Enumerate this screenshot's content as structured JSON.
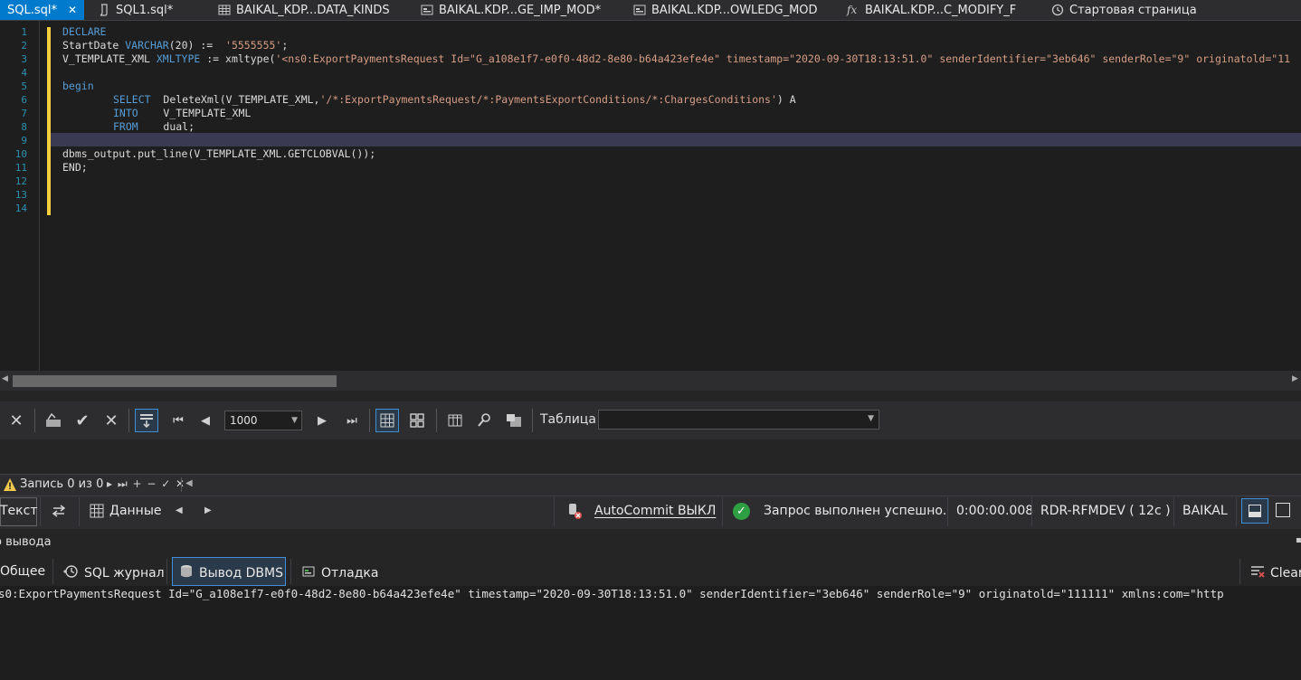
{
  "tabs": [
    {
      "label": "SQL.sql*",
      "icon": "none",
      "active": true
    },
    {
      "label": "SQL1.sql*",
      "icon": "script-icon"
    },
    {
      "label": "BAIKAL_KDP...DATA_KINDS",
      "icon": "table-icon"
    },
    {
      "label": "BAIKAL.KDP...GE_IMP_MOD*",
      "icon": "package-icon"
    },
    {
      "label": "BAIKAL.KDP...OWLEDG_MOD",
      "icon": "package-icon"
    },
    {
      "label": "BAIKAL.KDP...C_MODIFY_F",
      "icon": "function-icon"
    },
    {
      "label": "Стартовая страница",
      "icon": "start-page-icon"
    }
  ],
  "tab_close_symbol": "✕",
  "editor": {
    "line_numbers": [
      "1",
      "2",
      "3",
      "4",
      "5",
      "6",
      "7",
      "8",
      "9",
      "10",
      "11",
      "12",
      "13",
      "14"
    ],
    "lines": {
      "l1_kw": "DECLARE",
      "l2_a": "StartDate ",
      "l2_kw": "VARCHAR",
      "l2_b": "(20) :=  ",
      "l2_str": "'5555555'",
      "l2_c": ";",
      "l3_a": "V_TEMPLATE_XML ",
      "l3_kw": "XMLTYPE",
      "l3_b": " := xmltype(",
      "l3_str": "'<ns0:ExportPaymentsRequest Id=\"G_a108e1f7-e0f0-48d2-8e80-b64a423efe4e\" timestamp=\"2020-09-30T18:13:51.0\" senderIdentifier=\"3eb646\" senderRole=\"9\" originatold=\"11",
      "l5_kw": "begin",
      "l6_kw": "SELECT",
      "l6_a": "  DeleteXml(V_TEMPLATE_XML,",
      "l6_str": "'/*:ExportPaymentsRequest/*:PaymentsExportConditions/*:ChargesConditions'",
      "l6_b": ") A",
      "l7_kw": "INTO",
      "l7_a": "    V_TEMPLATE_XML",
      "l8_kw": "FROM",
      "l8_a": "    dual;",
      "l10": "dbms_output.put_line(V_TEMPLATE_XML.GETCLOBVAL());",
      "l11": "END;"
    }
  },
  "grid_toolbar": {
    "row_limit": "1000",
    "table_label": "Таблица",
    "table_value": ""
  },
  "record_bar": {
    "text": "Запись 0 из 0",
    "nav": "▸ ⏭ + − ✓ ✕"
  },
  "status_bar": {
    "text_tab": "Текст",
    "data_tab": "Данные",
    "autocommit": "AutoCommit ВЫКЛ",
    "query_status": "Запрос выполнен успешно.",
    "elapsed": "0:00:00.008",
    "connection": "RDR-RFMDEV ( 12c )",
    "schema": "BAIKAL"
  },
  "output": {
    "title": "о вывода",
    "tabs": {
      "general": "Общее",
      "sql_log": "SQL журнал",
      "dbms": "Вывод DBMS",
      "debug": "Отладка",
      "clear": "Clear"
    },
    "text": "s0:ExportPaymentsRequest Id=\"G_a108e1f7-e0f0-48d2-8e80-b64a423efe4e\" timestamp=\"2020-09-30T18:13:51.0\" senderIdentifier=\"3eb646\" senderRole=\"9\" originatold=\"111111\" xmlns:com=\"http"
  }
}
